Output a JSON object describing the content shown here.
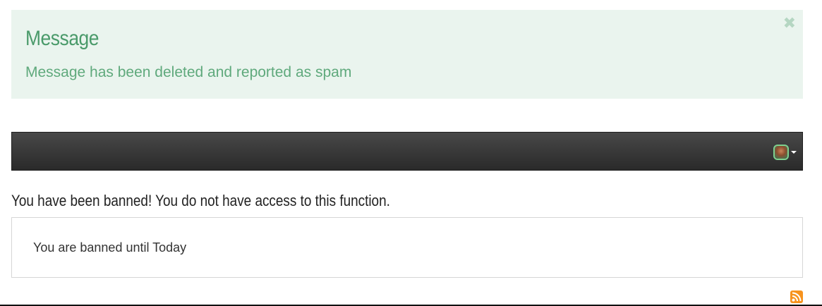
{
  "alert": {
    "title": "Message",
    "text": "Message has been deleted and reported as spam",
    "close_glyph": "✖"
  },
  "navbar": {
    "user_menu": {
      "avatar_icon": "user-avatar",
      "caret_icon": "caret-down-icon",
      "avatar_border_color": "#7ed08f"
    }
  },
  "main": {
    "heading": "You have been banned! You do not have access to this function.",
    "panel_text": "You are banned until Today"
  },
  "footer": {
    "rss_icon": "rss-icon",
    "rss_color": "#f7931e"
  }
}
